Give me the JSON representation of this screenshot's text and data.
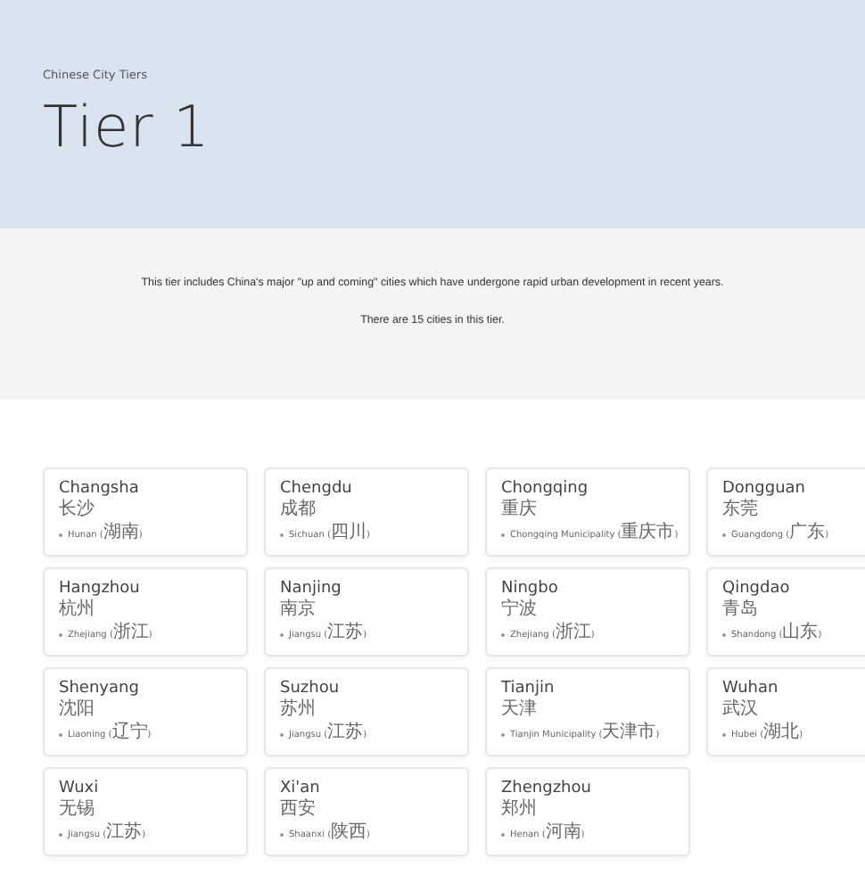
{
  "header": {
    "eyebrow": "Chinese City Tiers",
    "title": "Tier 1"
  },
  "intro": {
    "description": "This tier includes China's major \"up and coming\" cities which have undergone rapid urban development in recent years.",
    "count": "There are 15 cities in this tier."
  },
  "cities": [
    {
      "name": "Changsha",
      "chinese": "长沙",
      "province": "Hunan (湖南)"
    },
    {
      "name": "Chengdu",
      "chinese": "成都",
      "province": "Sichuan (四川)"
    },
    {
      "name": "Chongqing",
      "chinese": "重庆",
      "province": "Chongqing Municipality (重庆市)"
    },
    {
      "name": "Dongguan",
      "chinese": "东莞",
      "province": "Guangdong (广东)"
    },
    {
      "name": "Hangzhou",
      "chinese": "杭州",
      "province": "Zhejiang (浙江)"
    },
    {
      "name": "Nanjing",
      "chinese": "南京",
      "province": "Jiangsu (江苏)"
    },
    {
      "name": "Ningbo",
      "chinese": "宁波",
      "province": "Zhejiang (浙江)"
    },
    {
      "name": "Qingdao",
      "chinese": "青岛",
      "province": "Shandong (山东)"
    },
    {
      "name": "Shenyang",
      "chinese": "沈阳",
      "province": "Liaoning (辽宁)"
    },
    {
      "name": "Suzhou",
      "chinese": "苏州",
      "province": "Jiangsu (江苏)"
    },
    {
      "name": "Tianjin",
      "chinese": "天津",
      "province": "Tianjin Municipality (天津市)"
    },
    {
      "name": "Wuhan",
      "chinese": "武汉",
      "province": "Hubei (湖北)"
    },
    {
      "name": "Wuxi",
      "chinese": "无锡",
      "province": "Jiangsu (江苏)"
    },
    {
      "name": "Xi'an",
      "chinese": "西安",
      "province": "Shaanxi (陕西)"
    },
    {
      "name": "Zhengzhou",
      "chinese": "郑州",
      "province": "Henan (河南)"
    }
  ]
}
